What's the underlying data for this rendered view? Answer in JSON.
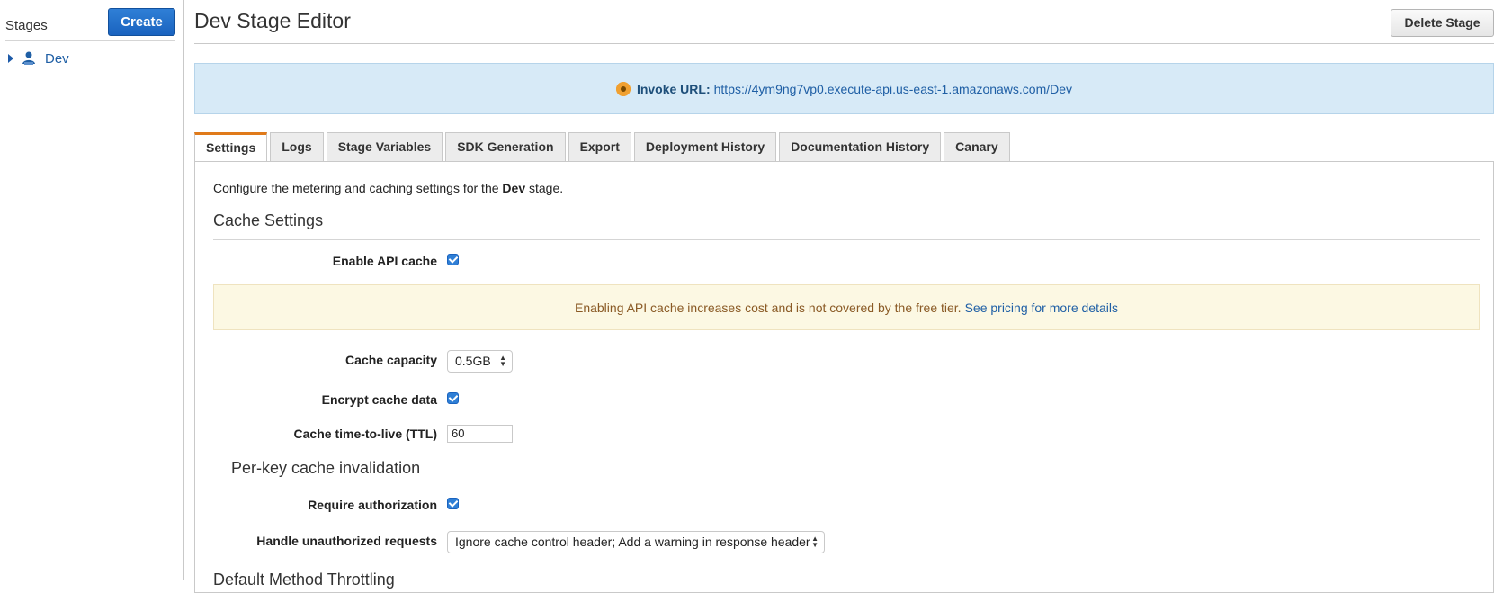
{
  "sidebar": {
    "title": "Stages",
    "create_label": "Create",
    "stages": [
      {
        "label": "Dev"
      }
    ]
  },
  "header": {
    "title": "Dev Stage Editor",
    "delete_label": "Delete Stage"
  },
  "invoke": {
    "label": "Invoke URL:",
    "url": "https://4ym9ng7vp0.execute-api.us-east-1.amazonaws.com/Dev"
  },
  "tabs": [
    {
      "label": "Settings",
      "active": true
    },
    {
      "label": "Logs"
    },
    {
      "label": "Stage Variables"
    },
    {
      "label": "SDK Generation"
    },
    {
      "label": "Export"
    },
    {
      "label": "Deployment History"
    },
    {
      "label": "Documentation History"
    },
    {
      "label": "Canary"
    }
  ],
  "settings": {
    "intro_prefix": "Configure the metering and caching settings for the",
    "intro_stage": "Dev",
    "intro_suffix": "stage.",
    "cache_heading": "Cache Settings",
    "enable_cache_label": "Enable API cache",
    "enable_cache_checked": true,
    "warning_text": "Enabling API cache increases cost and is not covered by the free tier.",
    "warning_link": "See pricing for more details",
    "capacity_label": "Cache capacity",
    "capacity_value": "0.5GB",
    "encrypt_label": "Encrypt cache data",
    "encrypt_checked": true,
    "ttl_label": "Cache time-to-live (TTL)",
    "ttl_value": "60",
    "per_key_heading": "Per-key cache invalidation",
    "require_auth_label": "Require authorization",
    "require_auth_checked": true,
    "unauth_label": "Handle unauthorized requests",
    "unauth_value": "Ignore cache control header; Add a warning in response header",
    "throttling_heading": "Default Method Throttling"
  },
  "colors": {
    "primary_button": "#1a63bf",
    "link": "#1f5fa5",
    "active_tab_accent": "#e07a1a",
    "info_banner": "#d7eaf7",
    "warning_banner": "#fcf8e3"
  }
}
